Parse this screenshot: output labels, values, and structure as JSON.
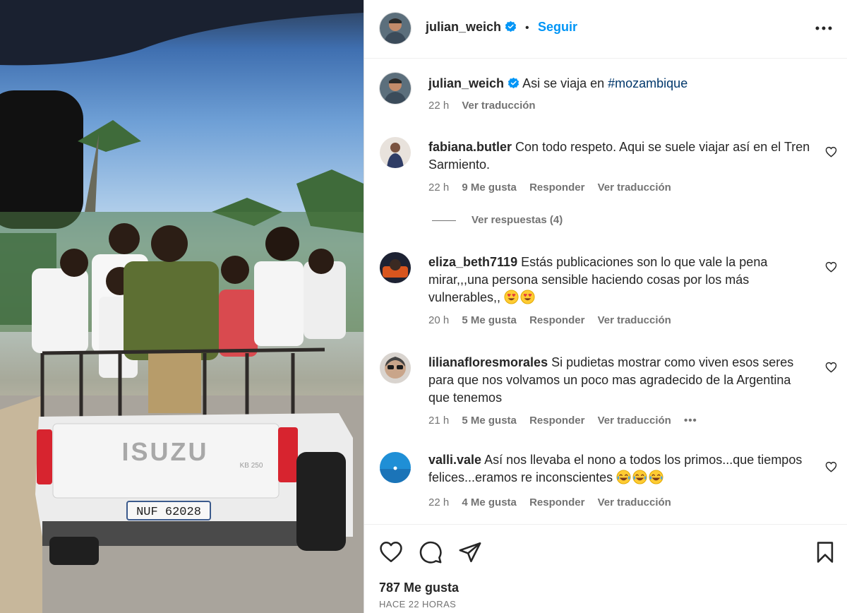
{
  "photo": {
    "plate_text": "NUF 62028",
    "brand_text": "ISUZU",
    "badge_text": "KB 250"
  },
  "header": {
    "username": "julian_weich",
    "separator": "•",
    "follow_label": "Seguir"
  },
  "caption": {
    "username": "julian_weich",
    "text": "Asi se viaja en ",
    "hashtag": "#mozambique",
    "time": "22 h",
    "translate": "Ver traducción"
  },
  "comments": [
    {
      "username": "fabiana.butler",
      "text": "Con todo respeto. Aqui se suele viajar así en el Tren Sarmiento.",
      "time": "22 h",
      "likes": "9 Me gusta",
      "reply": "Responder",
      "translate": "Ver traducción"
    },
    {
      "username": "eliza_beth7119",
      "text": "Estás publicaciones son lo que vale la pena mirar,,,una persona sensible haciendo cosas por los más vulnerables,,",
      "emoji_count": 2,
      "emoji": "heart-eyes",
      "time": "20 h",
      "likes": "5 Me gusta",
      "reply": "Responder",
      "translate": "Ver traducción"
    },
    {
      "username": "lilianafloresmorales",
      "text": "Si pudietas mostrar como viven esos seres para que nos volvamos un poco mas agradecido de la Argentina que tenemos",
      "time": "21 h",
      "likes": "5 Me gusta",
      "reply": "Responder",
      "translate": "Ver traducción",
      "more": "•••"
    },
    {
      "username": "valli.vale",
      "text": "Así nos llevaba el nono a todos los primos...que tiempos felices...eramos re inconscientes",
      "emoji_count": 3,
      "emoji": "tears-of-joy",
      "time": "22 h",
      "likes": "4 Me gusta",
      "reply": "Responder",
      "translate": "Ver traducción"
    }
  ],
  "replies_toggle": "Ver respuestas (4)",
  "footer": {
    "likes": "787 Me gusta",
    "time_ago": "HACE 22 HORAS"
  },
  "colors": {
    "link": "#0095f6",
    "hashtag": "#00376b",
    "muted": "#737373",
    "text": "#262626"
  }
}
